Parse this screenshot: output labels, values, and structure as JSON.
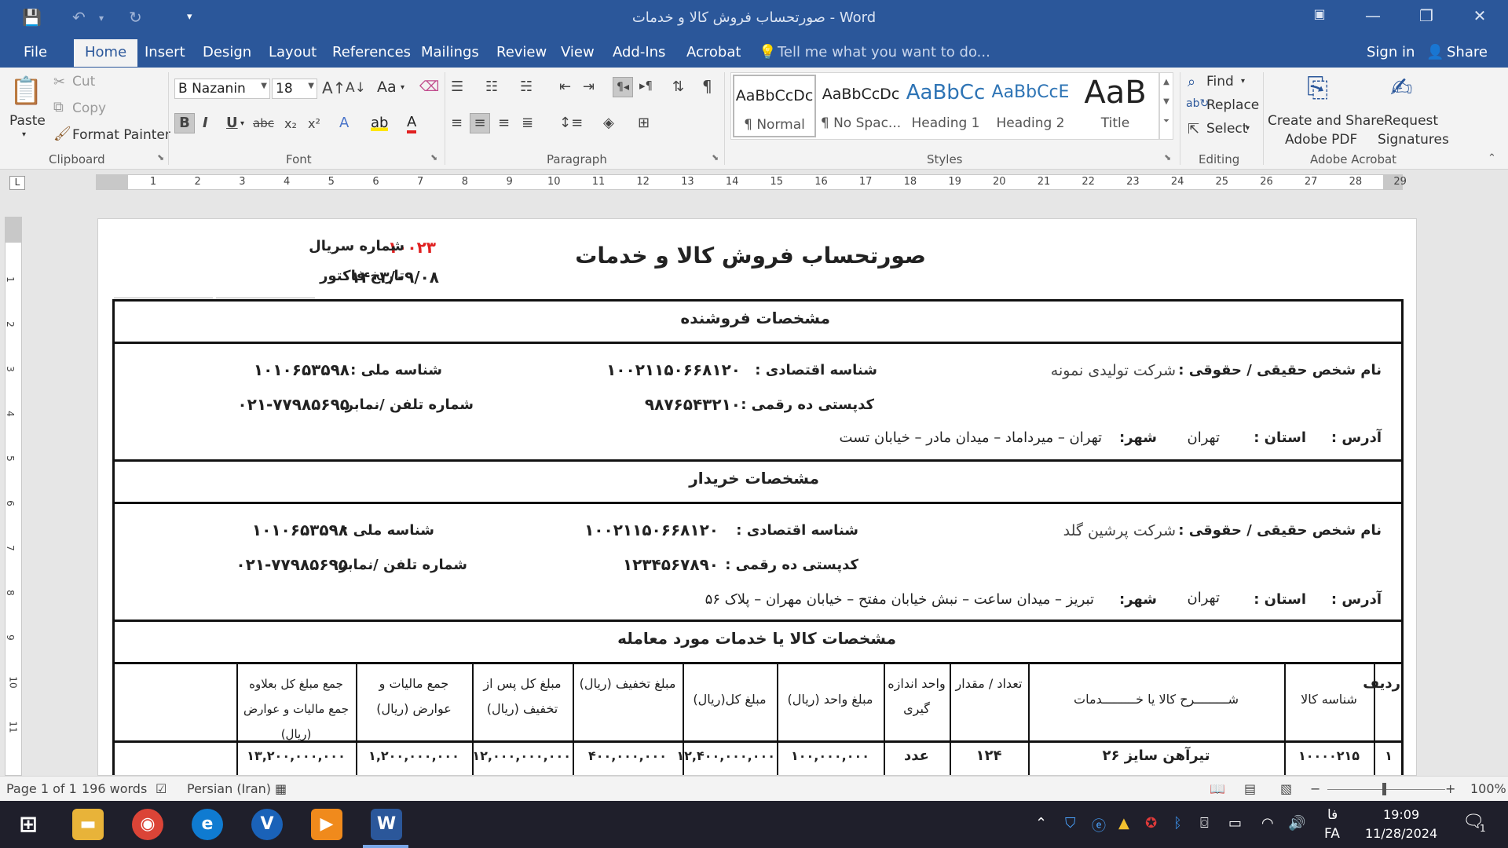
{
  "window": {
    "title": "صورتحساب فروش کالا و خدمات - Word"
  },
  "menu": {
    "file": "File",
    "home": "Home",
    "insert": "Insert",
    "design": "Design",
    "layout": "Layout",
    "references": "References",
    "mailings": "Mailings",
    "review": "Review",
    "view": "View",
    "addins": "Add-Ins",
    "acrobat": "Acrobat",
    "tellme": "Tell me what you want to do...",
    "signin": "Sign in",
    "share": "Share"
  },
  "ribbon": {
    "clipboard": {
      "label": "Clipboard",
      "paste": "Paste",
      "cut": "Cut",
      "copy": "Copy",
      "format_painter": "Format Painter"
    },
    "font": {
      "label": "Font",
      "font_name": "B Nazanin",
      "font_size": "18",
      "case": "Aa"
    },
    "paragraph": {
      "label": "Paragraph"
    },
    "styles": {
      "label": "Styles",
      "items": [
        {
          "preview": "AaBbCcDc",
          "name": "¶ Normal"
        },
        {
          "preview": "AaBbCcDc",
          "name": "¶ No Spac..."
        },
        {
          "preview": "AaBbCc",
          "name": "Heading 1"
        },
        {
          "preview": "AaBbCcE",
          "name": "Heading 2"
        },
        {
          "preview": "AaB",
          "name": "Title"
        }
      ]
    },
    "editing": {
      "label": "Editing",
      "find": "Find",
      "replace": "Replace",
      "select": "Select"
    },
    "acrobat": {
      "label": "Adobe Acrobat",
      "create_line1": "Create and Share",
      "create_line2": "Adobe PDF",
      "request_line1": "Request",
      "request_line2": "Signatures"
    }
  },
  "ruler": {
    "numbers": [
      "1",
      "2",
      "3",
      "4",
      "5",
      "6",
      "7",
      "8",
      "9",
      "10",
      "11",
      "12",
      "13",
      "14",
      "15",
      "16",
      "17",
      "18",
      "19",
      "20",
      "21",
      "22",
      "23",
      "24",
      "25",
      "26",
      "27",
      "28",
      "29"
    ],
    "vertical": [
      "1",
      "2",
      "3",
      "4",
      "5",
      "6",
      "7",
      "8",
      "9",
      "10",
      "11"
    ]
  },
  "document": {
    "serial_label": "شماره سریال",
    "serial_value": "۱۰۰۲۳",
    "date_label": "تاریخ فاکتور",
    "date_value": "۱۴۰۳/۰۹/۰۸",
    "title": "صورتحساب فروش کالا و خدمات",
    "seller": {
      "header": "مشخصات فروشنده",
      "name_label": "نام شخص حقیقی / حقوقی :",
      "name_value": "شرکت تولیدی نمونه",
      "econ_label": "شناسه اقتصادی :",
      "econ_value": "۱۰۰۲۱۱۵۰۶۶۸۱۲۰",
      "national_label": "شناسه ملی :",
      "national_value": "۱۰۱۰۶۵۳۵۹۸",
      "postal_label": "کدپستی ده رقمی :",
      "postal_value": "۹۸۷۶۵۴۳۲۱۰",
      "phone_label": "شماره تلفن /نمابر:",
      "phone_value": "۰۲۱-۷۷۹۸۵۶۹۵",
      "address_label": "آدرس :",
      "province_label": "استان :",
      "province_value": "تهران",
      "city_label": "شهر:",
      "city_value": "تهران – میرداماد – میدان مادر – خیابان تست"
    },
    "buyer": {
      "header": "مشخصات خریدار",
      "name_label": "نام شخص حقیقی / حقوقی :",
      "name_value": "شرکت پرشین گلد",
      "econ_label": "شناسه اقتصادی :",
      "econ_value": "۱۰۰۲۱۱۵۰۶۶۸۱۲۰",
      "national_label": "شناسه ملی :",
      "national_value": "۱۰۱۰۶۵۳۵۹۸",
      "postal_label": "کدپستی ده رقمی :",
      "postal_value": "۱۲۳۴۵۶۷۸۹۰",
      "phone_label": "شماره تلفن /نمابر:",
      "phone_value": "۰۲۱-۷۷۹۸۵۶۹۵",
      "address_label": "آدرس :",
      "province_label": "استان :",
      "province_value": "تهران",
      "city_label": "شهر:",
      "city_value": "تبریز – میدان ساعت – نبش خیابان مفتح – خیابان مهران – پلاک ۵۶"
    },
    "goods": {
      "header": "مشخصات کالا یا خدمات مورد معامله",
      "columns": [
        "ردیف",
        "شناسه کالا",
        "شـــــــــرح کالا یا خـــــــــدمات",
        "تعداد / مقدار",
        "واحد اندازه گیری",
        "مبلغ واحد (ریال)",
        "مبلغ کل(ریال)",
        "مبلغ تخفیف (ریال)",
        "مبلغ کل پس از تخفیف (ریال)",
        "جمع مالیات و عوارض (ریال)",
        "جمع مبلغ کل بعلاوه جمع مالیات و عوارض (ریال)"
      ],
      "rows": [
        [
          "۱",
          "۱۰۰۰۰۲۱۵",
          "تیرآهن سایز ۲۶",
          "۱۲۴",
          "عدد",
          "۱۰۰,۰۰۰,۰۰۰",
          "۱۲,۴۰۰,۰۰۰,۰۰۰",
          "۴۰۰,۰۰۰,۰۰۰",
          "۱۲,۰۰۰,۰۰۰,۰۰۰",
          "۱,۲۰۰,۰۰۰,۰۰۰",
          "۱۳,۲۰۰,۰۰۰,۰۰۰"
        ]
      ]
    }
  },
  "status": {
    "page": "Page 1 of 1",
    "words": "196 words",
    "language": "Persian (Iran)",
    "zoom": "100%"
  },
  "taskbar": {
    "lang_short": "فا",
    "lang": "FA",
    "time": "19:09",
    "date": "11/28/2024",
    "notifications": "1"
  },
  "colors": {
    "word_blue": "#2b579a",
    "serial_red": "#e02020"
  }
}
